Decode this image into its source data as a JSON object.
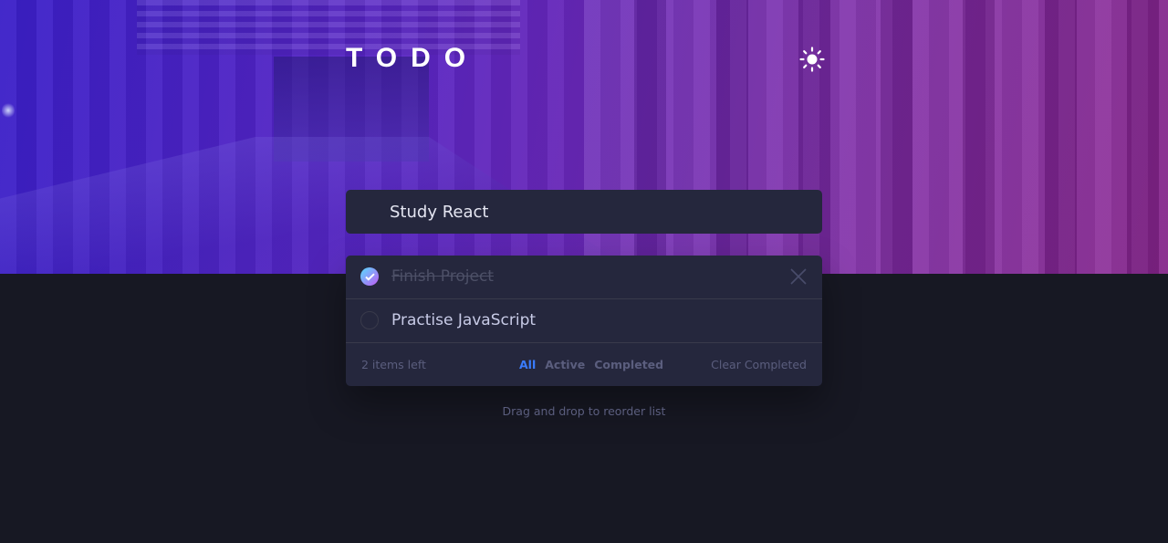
{
  "app": {
    "title": "TODO"
  },
  "header": {
    "theme_toggle_icon": "sun-icon"
  },
  "new_todo": {
    "value": "Study React"
  },
  "todos": [
    {
      "text": "Finish Project",
      "completed": true
    },
    {
      "text": "Practise JavaScript",
      "completed": false
    }
  ],
  "footer": {
    "items_left": "2 items left",
    "filters": [
      {
        "label": "All",
        "active": true
      },
      {
        "label": "Active",
        "active": false
      },
      {
        "label": "Completed",
        "active": false
      }
    ],
    "clear_label": "Clear Completed"
  },
  "hint": "Drag and drop to reorder list",
  "colors": {
    "background": "#171823",
    "card": "#25273d",
    "active_filter": "#3a7cfd",
    "check_gradient_start": "#57ddff",
    "check_gradient_end": "#c058f3"
  }
}
